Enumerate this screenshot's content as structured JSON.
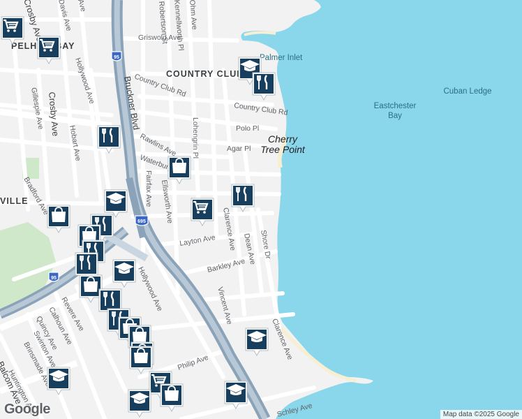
{
  "map": {
    "places": {
      "country_club": "COUNTRY CLUB",
      "pelham_bay": "PELHAM BAY",
      "ville": "VILLE",
      "cherry_tree_point_1": "Cherry",
      "cherry_tree_point_2": "Tree Point",
      "palmer_inlet": "Palmer Inlet",
      "eastchester_bay_1": "Eastchester",
      "eastchester_bay_2": "Bay",
      "cuban_ledge": "Cuban Ledge"
    },
    "streets": {
      "griswold": "Griswold Ave",
      "country_club_rd_w": "Country Club Rd",
      "country_club_rd_e": "Country Club Rd",
      "polo": "Polo Pl",
      "agar": "Agar Pl",
      "rawlins": "Rawlins Ave",
      "waterbury": "Waterbury Ave",
      "lohengrin": "Lohengrin Pl",
      "fairfax": "Fairfax Ave",
      "ellsworth": "Ellsworth Ave",
      "clarence_n": "Clarence Ave",
      "clarence_s": "Clarence Ave",
      "dean": "Dean Ave",
      "shore": "Shore Dr",
      "layton": "Layton Ave",
      "barkley": "Barkley Ave",
      "vincent": "Vincent Ave",
      "hollywood_w": "Hollywood Ave",
      "hollywood_e": "Hollywood Ave",
      "bruckner": "Bruckner Blvd",
      "crosby": "Crosby Ave",
      "hobart": "Hobart Ave",
      "gillespie": "Gillespie Ave",
      "bradford": "Bradford Ave",
      "revere": "Revere Ave",
      "calhoun": "Calhoun Ave",
      "quincy": "Quincy Ave",
      "swinton": "Swinton Ave",
      "brinsmade": "Brinsmade Ave",
      "huntington": "Huntington Ave",
      "balcom": "Balcom Ave",
      "philip": "Philip Ave",
      "schley": "Schley Ave",
      "robertson": "Robertson St",
      "kennellworth": "Kennellworth Pl",
      "ohm": "Ohm Ave",
      "davis": "Davis Ave",
      "crosby_top": "Crosby Ave",
      "harding_ish": "Ave"
    },
    "shields": {
      "i95_north": "95",
      "i695": "695",
      "i95_south": "95"
    }
  },
  "pins": [
    {
      "icon": "shopping-cart-icon",
      "label": "Shopping"
    },
    {
      "icon": "shopping-cart-icon",
      "label": "Shopping"
    },
    {
      "icon": "graduation-cap-icon",
      "label": "School"
    },
    {
      "icon": "restaurant-icon",
      "label": "Restaurant"
    },
    {
      "icon": "restaurant-icon",
      "label": "Restaurant"
    },
    {
      "icon": "shopping-bag-icon",
      "label": "Store"
    },
    {
      "icon": "restaurant-icon",
      "label": "Restaurant"
    },
    {
      "icon": "graduation-cap-icon",
      "label": "School"
    },
    {
      "icon": "shopping-cart-icon",
      "label": "Shopping"
    },
    {
      "icon": "shopping-bag-icon",
      "label": "Store"
    },
    {
      "icon": "restaurant-icon",
      "label": "Restaurant"
    },
    {
      "icon": "shopping-bag-icon",
      "label": "Store"
    },
    {
      "icon": "restaurant-icon",
      "label": "Restaurant"
    },
    {
      "icon": "restaurant-icon",
      "label": "Restaurant"
    },
    {
      "icon": "graduation-cap-icon",
      "label": "School"
    },
    {
      "icon": "shopping-bag-icon",
      "label": "Store"
    },
    {
      "icon": "restaurant-icon",
      "label": "Restaurant"
    },
    {
      "icon": "restaurant-icon",
      "label": "Restaurant"
    },
    {
      "icon": "shopping-bag-icon",
      "label": "Store"
    },
    {
      "icon": "shopping-bag-icon",
      "label": "Store"
    },
    {
      "icon": "shopping-bag-icon",
      "label": "Store"
    },
    {
      "icon": "shopping-bag-icon",
      "label": "Store"
    },
    {
      "icon": "shopping-cart-icon",
      "label": "Shopping"
    },
    {
      "icon": "shopping-bag-icon",
      "label": "Store"
    },
    {
      "icon": "graduation-cap-icon",
      "label": "School"
    },
    {
      "icon": "graduation-cap-icon",
      "label": "School"
    },
    {
      "icon": "graduation-cap-icon",
      "label": "School"
    },
    {
      "icon": "graduation-cap-icon",
      "label": "School"
    }
  ],
  "footer": {
    "google_logo": "Google",
    "attribution": "Map data ©2025 Google"
  },
  "colors": {
    "water": "#8ad6ea",
    "land": "#f2f2f2",
    "park": "#cfe8c9",
    "highway": "#8aa3b8",
    "pin": "#173e5c",
    "beach": "#f7efd4"
  }
}
